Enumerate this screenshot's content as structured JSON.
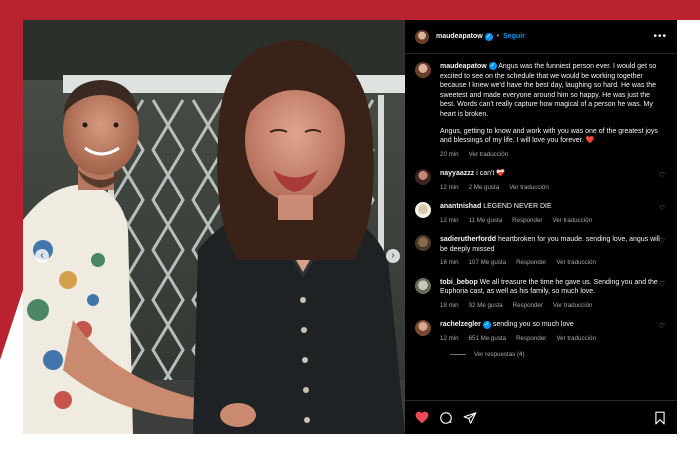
{
  "colors": {
    "brand_red": "#b8232f",
    "verified_blue": "#0095f6",
    "like_red": "#ed4956",
    "muted": "#a8a8a8"
  },
  "header": {
    "username": "maudeapatow",
    "follow_label": "Seguir",
    "separator": "•",
    "more_icon": "more-horizontal-icon"
  },
  "caption": {
    "username": "maudeapatow",
    "paragraph1": "Angus was the funniest person ever. I would get so excited to see on the schedule that we would be working together because I knew we'd have the best day, laughing so hard. He was the sweetest and made everyone around him so happy. He was just the best. Words can't really capture how magical of a person he was. My heart is broken.",
    "paragraph2": "Angus, getting to know and work with you was one of the greatest joys and blessings of my life. I will love you forever. ❤️",
    "time": "20 min",
    "translate": "Ver traducción"
  },
  "comments": [
    {
      "username": "nayyaazzz",
      "text": "i can't ❤️‍🩹",
      "time": "12 min",
      "likes": "2 Me gusta",
      "translate": "Ver traducción"
    },
    {
      "username": "anantnishad",
      "text": "LEGEND NEVER DIE",
      "time": "12 min",
      "likes": "11 Me gusta",
      "reply": "Responder",
      "translate": "Ver traducción"
    },
    {
      "username": "sadierutherfordd",
      "text": "heartbroken for you maude. sending love, angus will be deeply missed",
      "time": "16 min",
      "likes": "107 Me gusta",
      "reply": "Responder",
      "translate": "Ver traducción"
    },
    {
      "username": "tobi_bebop",
      "text": "We all treasure the time he gave us. Sending you and the Euphoria cast, as well as his family, so much love.",
      "time": "18 min",
      "likes": "92 Me gusta",
      "reply": "Responder",
      "translate": "Ver traducción"
    },
    {
      "username": "rachelzegler",
      "text": "sending you so much love",
      "time": "12 min",
      "likes": "651 Me gusta",
      "reply": "Responder",
      "translate": "Ver traducción"
    }
  ],
  "view_replies": "Ver respuestas (4)",
  "actions": [
    "heart-filled-icon",
    "comment-icon",
    "share-icon",
    "bookmark-icon"
  ]
}
